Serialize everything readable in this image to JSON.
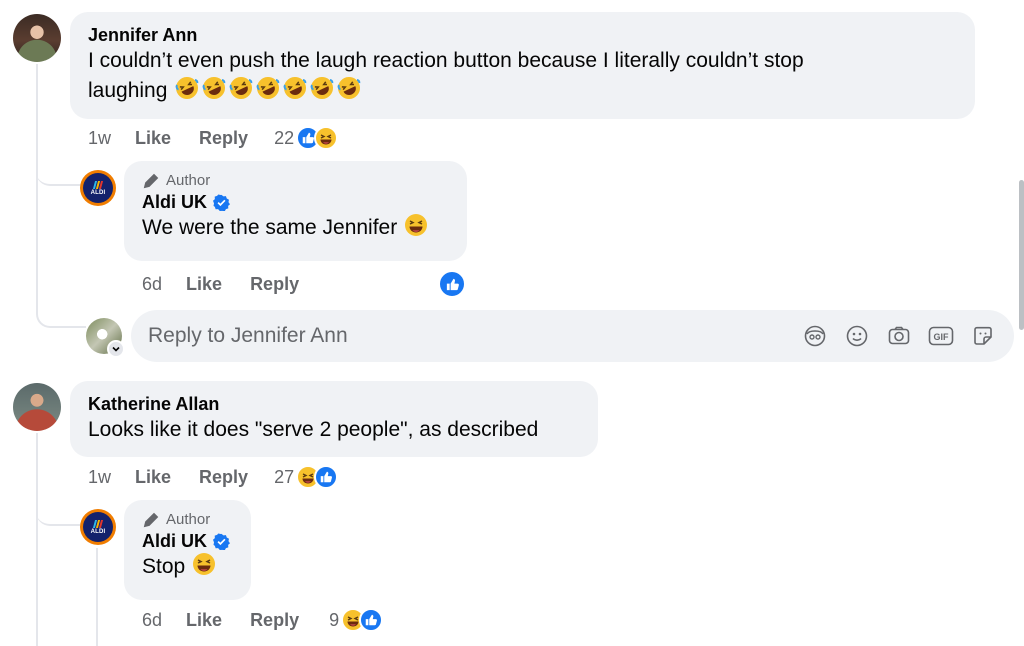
{
  "comments": [
    {
      "author": "Jennifer Ann",
      "text": "I couldn’t even push the laugh reaction button because I literally couldn’t stop",
      "text_line2": "laughing",
      "emoji_count": 7,
      "time": "1w",
      "like_label": "Like",
      "reply_label": "Reply",
      "reaction_count": "22",
      "reactions": [
        "like",
        "haha"
      ],
      "replies": [
        {
          "badge": "Author",
          "author": "Aldi UK",
          "verified": true,
          "text": "We were the same Jennifer",
          "time": "6d",
          "like_label": "Like",
          "reply_label": "Reply",
          "reactions": [
            "like"
          ]
        }
      ]
    },
    {
      "author": "Katherine Allan",
      "text": "Looks like it does \"serve 2 people\", as described",
      "time": "1w",
      "like_label": "Like",
      "reply_label": "Reply",
      "reaction_count": "27",
      "reactions": [
        "haha",
        "like"
      ],
      "replies": [
        {
          "badge": "Author",
          "author": "Aldi UK",
          "verified": true,
          "text": "Stop",
          "time": "6d",
          "like_label": "Like",
          "reply_label": "Reply",
          "reaction_count": "9",
          "reactions": [
            "haha",
            "like"
          ]
        }
      ]
    }
  ],
  "reply_input": {
    "placeholder": "Reply to Jennifer Ann",
    "icons": [
      "avatar-sticker-icon",
      "emoji-icon",
      "camera-icon",
      "gif-icon",
      "sticker-icon"
    ]
  },
  "logo_text": "ALDI",
  "colors": {
    "bubble": "#f0f2f5",
    "secondary_text": "#65676b",
    "like_blue": "#1877f2",
    "haha_yellow": "#f7c12c",
    "aldi_orange": "#f07d00",
    "aldi_navy": "#14226c"
  }
}
